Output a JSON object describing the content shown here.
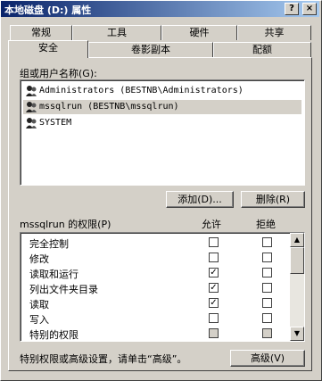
{
  "window": {
    "title": "本地磁盘 (D:) 属性",
    "help_button": "?",
    "close_button": "×"
  },
  "tabs_row_back": [
    "常规",
    "工具",
    "硬件",
    "共享"
  ],
  "tabs_row_front": [
    "安全",
    "卷影副本",
    "配额"
  ],
  "active_tab": "安全",
  "group_label": "组或用户名称(G):",
  "users": [
    {
      "name": "Administrators (BESTNB\\Administrators)",
      "selected": false
    },
    {
      "name": "mssqlrun (BESTNB\\mssqlrun)",
      "selected": true
    },
    {
      "name": "SYSTEM",
      "selected": false
    }
  ],
  "buttons": {
    "add": "添加(D)...",
    "remove": "删除(R)",
    "advanced": "高级(V)"
  },
  "permissions_label": "mssqlrun 的权限(P)",
  "allow_header": "允许",
  "deny_header": "拒绝",
  "permissions": [
    {
      "name": "完全控制",
      "allow": false,
      "deny": false,
      "allow_disabled": false
    },
    {
      "name": "修改",
      "allow": false,
      "deny": false,
      "allow_disabled": false
    },
    {
      "name": "读取和运行",
      "allow": true,
      "deny": false,
      "allow_disabled": false
    },
    {
      "name": "列出文件夹目录",
      "allow": true,
      "deny": false,
      "allow_disabled": false
    },
    {
      "name": "读取",
      "allow": true,
      "deny": false,
      "allow_disabled": false
    },
    {
      "name": "写入",
      "allow": false,
      "deny": false,
      "allow_disabled": false
    },
    {
      "name": "特别的权限",
      "allow": false,
      "deny": false,
      "allow_disabled": true
    }
  ],
  "footer_note": "特别权限或高级设置，请单击“高级”。"
}
